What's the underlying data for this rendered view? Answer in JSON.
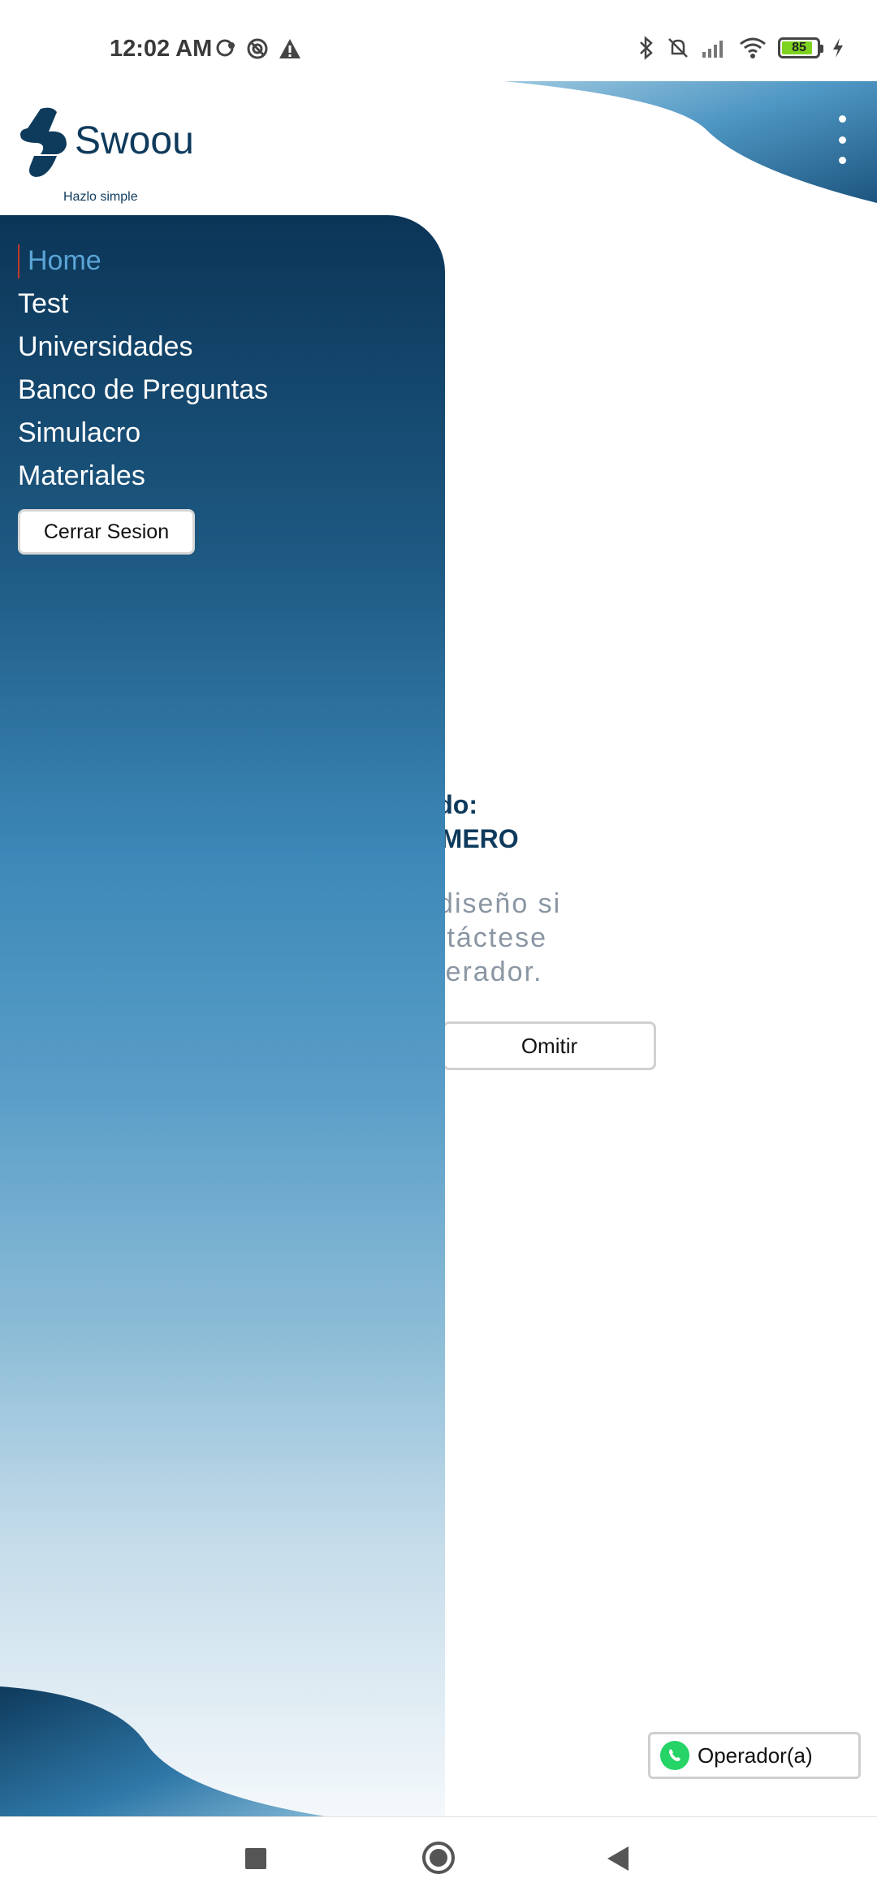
{
  "status_bar": {
    "time": "12:02 AM",
    "battery_level": "85",
    "left_icons": [
      "chat-bubble-icon",
      "focus-mode-icon",
      "warning-icon"
    ],
    "right_icons": [
      "bluetooth-icon",
      "silent-icon",
      "signal-icon",
      "wifi-icon",
      "battery-icon",
      "charging-icon"
    ]
  },
  "header": {
    "brand": "Swoou",
    "tagline": "Hazlo simple",
    "menu_icon": "kebab-menu-icon"
  },
  "drawer": {
    "items": [
      {
        "label": "Home",
        "active": true
      },
      {
        "label": "Test",
        "active": false
      },
      {
        "label": "Universidades",
        "active": false
      },
      {
        "label": "Banco de Preguntas",
        "active": false
      },
      {
        "label": "Simulacro",
        "active": false
      },
      {
        "label": "Materiales",
        "active": false
      }
    ],
    "logout_label": "Cerrar Sesion"
  },
  "main": {
    "welcome_line_1": "enido:",
    "welcome_line_2": "UE ROMERO",
    "message_lines": [
      "stá en rediseño si",
      "ucto contáctese",
      "on el operador."
    ],
    "omit_label": "Omitir"
  },
  "operator": {
    "label": "Operador(a)",
    "icon": "whatsapp-icon"
  },
  "colors": {
    "brand_dark": "#0e3a5c",
    "active_item": "#5aa5d6",
    "accent_line": "#c0392b"
  }
}
